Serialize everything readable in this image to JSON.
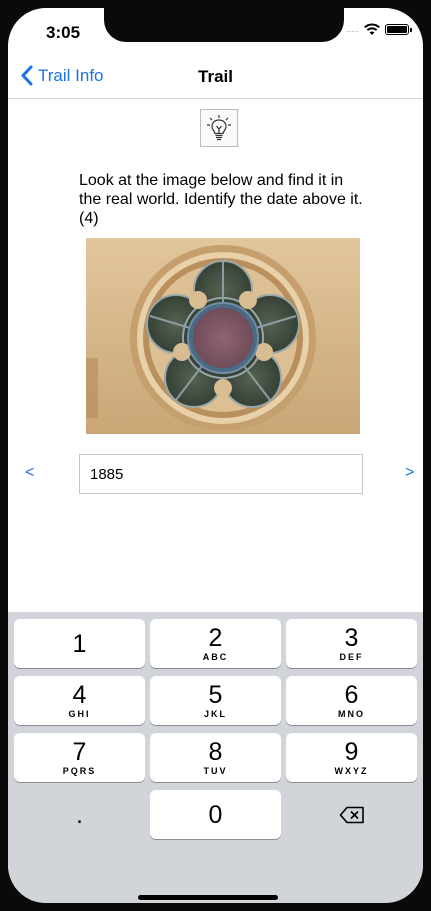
{
  "status_bar": {
    "time": "3:05",
    "signal": "....."
  },
  "navbar": {
    "back_label": "Trail Info",
    "title": "Trail"
  },
  "hint": {
    "icon": "lightbulb-icon"
  },
  "question": {
    "text": "Look at the image below and find it in the real world. Identify the date above it. (4)"
  },
  "photo": {
    "subject": "stained-glass-quatrefoil-window"
  },
  "answer": {
    "value": "1885"
  },
  "pager": {
    "prev_label": "<",
    "next_label": ">"
  },
  "keyboard": {
    "keys": [
      {
        "num": "1",
        "letters": ""
      },
      {
        "num": "2",
        "letters": "ABC"
      },
      {
        "num": "3",
        "letters": "DEF"
      },
      {
        "num": "4",
        "letters": "GHI"
      },
      {
        "num": "5",
        "letters": "JKL"
      },
      {
        "num": "6",
        "letters": "MNO"
      },
      {
        "num": "7",
        "letters": "PQRS"
      },
      {
        "num": "8",
        "letters": "TUV"
      },
      {
        "num": "9",
        "letters": "WXYZ"
      },
      {
        "num": ".",
        "letters": ""
      },
      {
        "num": "0",
        "letters": ""
      }
    ],
    "delete_icon": "backspace-icon"
  },
  "colors": {
    "accent": "#1a73e8",
    "keyboard_bg": "#d1d4d9"
  }
}
